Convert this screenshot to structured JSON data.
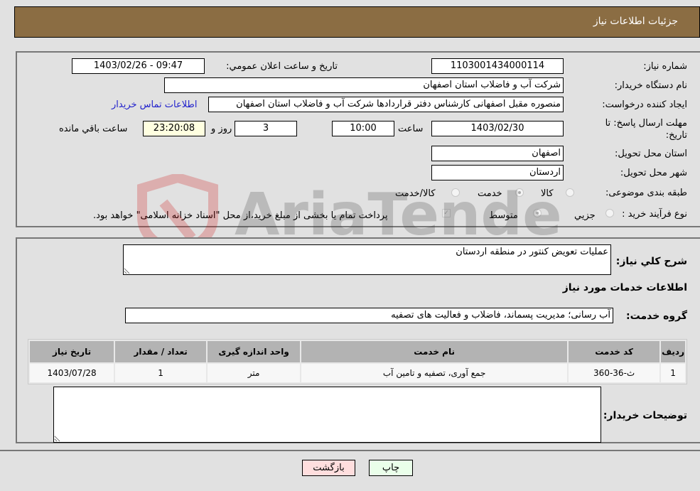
{
  "header": {
    "title": "جزئیات اطلاعات نیاز"
  },
  "fields": {
    "need_number": {
      "label": "شماره نیاز:",
      "value": "1103001434000114"
    },
    "announce_datetime": {
      "label": "تاریخ و ساعت اعلان عمومي:",
      "value": "1403/02/26 - 09:47"
    },
    "buyer_org": {
      "label": "نام دستگاه خريدار:",
      "value": "شرکت آب و فاضلاب استان اصفهان"
    },
    "creator": {
      "label": "ایجاد کننده درخواست:",
      "value": "منصوره مقبل اصفهانی کارشناس دفتر قراردادها شرکت آب و فاضلاب استان اصفهان"
    },
    "buyer_contact_link": "اطلاعات تماس خریدار",
    "deadline": {
      "label_line1": "مهلت ارسال پاسخ: تا",
      "label_line2": "تاریخ:",
      "date": "1403/02/30",
      "time_label": "ساعت",
      "time": "10:00",
      "days": "3",
      "days_label": "روز و",
      "remaining": "23:20:08",
      "remaining_label": "ساعت باقي مانده"
    },
    "province": {
      "label": "استان محل تحویل:",
      "value": "اصفهان"
    },
    "city": {
      "label": "شهر محل تحویل:",
      "value": "اردستان"
    },
    "category": {
      "label": "طبقه بندی موضوعی:",
      "options": [
        "کالا",
        "خدمت",
        "کالا/خدمت"
      ],
      "selected": "خدمت"
    },
    "purchase_type": {
      "label": "نوع فرآیند خرید :",
      "options": [
        "جزيي",
        "متوسط"
      ],
      "selected": "متوسط",
      "treasury_note": "پرداخت تمام یا بخشی از مبلغ خرید،از محل \"اسناد خزانه اسلامی\" خواهد بود.",
      "treasury_checked": true
    }
  },
  "description": {
    "label": "شرح كلي نياز:",
    "value": "عملیات تعویض کنتور در منطقه اردستان"
  },
  "services_section_title": "اطلاعات خدمات مورد نیاز",
  "service_group": {
    "label": "گروه خدمت:",
    "value": "آب رسانی؛ مدیریت پسماند، فاضلاب و فعالیت های تصفیه"
  },
  "table": {
    "headers": [
      "ردیف",
      "کد خدمت",
      "نام خدمت",
      "واحد اندازه گیری",
      "تعداد / مقدار",
      "تاریخ نیاز"
    ],
    "rows": [
      [
        "1",
        "ث-36-360",
        "جمع آوری، تصفیه و تامین آب",
        "متر",
        "1",
        "1403/07/28"
      ]
    ]
  },
  "buyer_notes": {
    "label": "توضیحات خریدار:",
    "value": ""
  },
  "buttons": {
    "print": "چاپ",
    "back": "بازگشت"
  },
  "watermark": "AriaTender.neT",
  "colors": {
    "header_bg": "#8b6d43",
    "link": "#2222cc",
    "back_btn": "#ffdede",
    "print_btn": "#eaffea"
  }
}
